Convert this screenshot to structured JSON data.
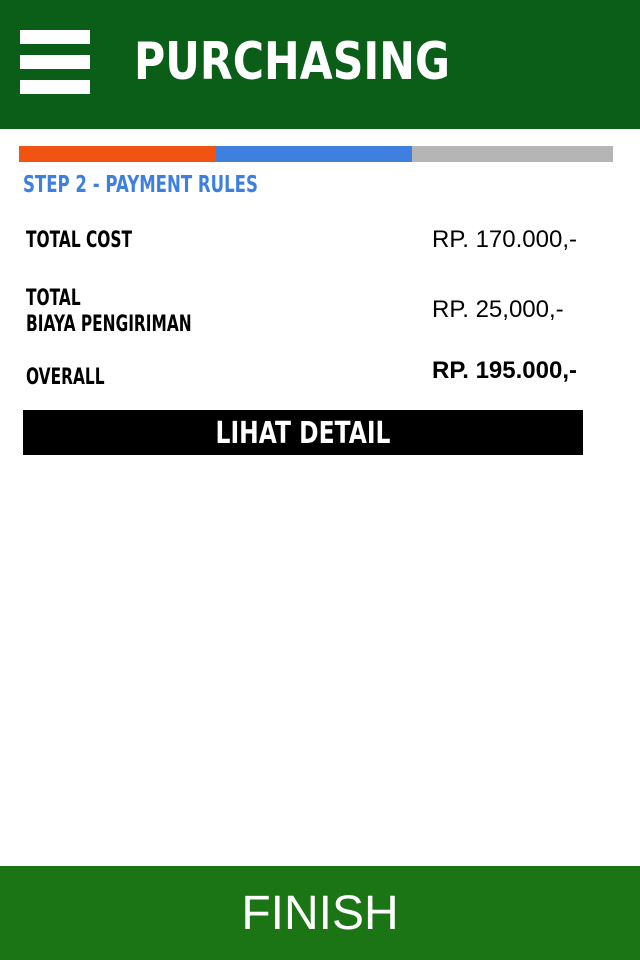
{
  "header": {
    "title": "PURCHASING",
    "menu_icon": "hamburger-menu-icon",
    "background": "#0b5e17"
  },
  "progress": {
    "steps": [
      {
        "color": "#f15412"
      },
      {
        "color": "#3e7fdf"
      },
      {
        "color": "#b5b5b5"
      }
    ]
  },
  "step": {
    "label": "STEP 2 - PAYMENT RULES",
    "color": "#3e7fdf"
  },
  "summary": {
    "total_cost": {
      "label": "TOTAL COST",
      "value": "RP. 170.000,-"
    },
    "shipping": {
      "label_line1": "TOTAL",
      "label_line2": "BIAYA PENGIRIMAN",
      "value": "RP. 25,000,-"
    },
    "overall": {
      "label": "OVERALL",
      "value": "RP. 195.000,-"
    }
  },
  "detail_button": {
    "label": "LIHAT DETAIL"
  },
  "finish_button": {
    "label": "FINISH",
    "background": "#1b7514"
  }
}
